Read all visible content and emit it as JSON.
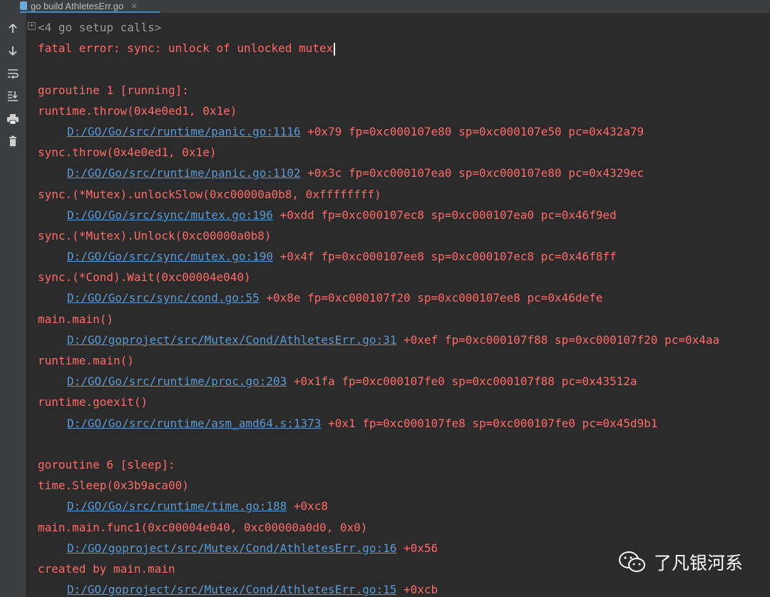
{
  "tab": {
    "title": "go build AthletesErr.go",
    "close": "×"
  },
  "toolbar": {
    "icons": [
      "up-arrow-icon",
      "down-arrow-icon",
      "soft-wrap-icon",
      "scroll-to-end-icon",
      "print-icon",
      "trash-icon"
    ]
  },
  "colors": {
    "error_text": "#ff6b68",
    "link": "#5a9bd5",
    "folded": "#9a9a9a",
    "background": "#2b2b2b"
  },
  "console": {
    "lines": [
      {
        "type": "folded",
        "text": "<4 go setup calls>"
      },
      {
        "type": "text",
        "text": "fatal error: sync: unlock of unlocked mutex"
      },
      {
        "type": "blank"
      },
      {
        "type": "text",
        "text": "goroutine 1 [running]:"
      },
      {
        "type": "text",
        "text": "runtime.throw(0x4e0ed1, 0x1e)"
      },
      {
        "type": "link",
        "link": "D:/GO/Go/src/runtime/panic.go:1116",
        "suffix": " +0x79 fp=0xc000107e80 sp=0xc000107e50 pc=0x432a79"
      },
      {
        "type": "text",
        "text": "sync.throw(0x4e0ed1, 0x1e)"
      },
      {
        "type": "link",
        "link": "D:/GO/Go/src/runtime/panic.go:1102",
        "suffix": " +0x3c fp=0xc000107ea0 sp=0xc000107e80 pc=0x4329ec"
      },
      {
        "type": "text",
        "text": "sync.(*Mutex).unlockSlow(0xc00000a0b8, 0xffffffff)"
      },
      {
        "type": "link",
        "link": "D:/GO/Go/src/sync/mutex.go:196",
        "suffix": " +0xdd fp=0xc000107ec8 sp=0xc000107ea0 pc=0x46f9ed"
      },
      {
        "type": "text",
        "text": "sync.(*Mutex).Unlock(0xc00000a0b8)"
      },
      {
        "type": "link",
        "link": "D:/GO/Go/src/sync/mutex.go:190",
        "suffix": " +0x4f fp=0xc000107ee8 sp=0xc000107ec8 pc=0x46f8ff"
      },
      {
        "type": "text",
        "text": "sync.(*Cond).Wait(0xc00004e040)"
      },
      {
        "type": "link",
        "link": "D:/GO/Go/src/sync/cond.go:55",
        "suffix": " +0x8e fp=0xc000107f20 sp=0xc000107ee8 pc=0x46defe"
      },
      {
        "type": "text",
        "text": "main.main()"
      },
      {
        "type": "link",
        "link": "D:/GO/goproject/src/Mutex/Cond/AthletesErr.go:31",
        "suffix": " +0xef fp=0xc000107f88 sp=0xc000107f20 pc=0x4aa"
      },
      {
        "type": "text",
        "text": "runtime.main()"
      },
      {
        "type": "link",
        "link": "D:/GO/Go/src/runtime/proc.go:203",
        "suffix": " +0x1fa fp=0xc000107fe0 sp=0xc000107f88 pc=0x43512a"
      },
      {
        "type": "text",
        "text": "runtime.goexit()"
      },
      {
        "type": "link",
        "link": "D:/GO/Go/src/runtime/asm_amd64.s:1373",
        "suffix": " +0x1 fp=0xc000107fe8 sp=0xc000107fe0 pc=0x45d9b1"
      },
      {
        "type": "blank"
      },
      {
        "type": "text",
        "text": "goroutine 6 [sleep]:"
      },
      {
        "type": "text",
        "text": "time.Sleep(0x3b9aca00)"
      },
      {
        "type": "link",
        "link": "D:/GO/Go/src/runtime/time.go:188",
        "suffix": " +0xc8"
      },
      {
        "type": "text",
        "text": "main.main.func1(0xc00004e040, 0xc00000a0d0, 0x0)"
      },
      {
        "type": "link",
        "link": "D:/GO/goproject/src/Mutex/Cond/AthletesErr.go:16",
        "suffix": " +0x56"
      },
      {
        "type": "text",
        "text": "created by main.main"
      },
      {
        "type": "link",
        "link": "D:/GO/goproject/src/Mutex/Cond/AthletesErr.go:15",
        "suffix": " +0xcb"
      }
    ]
  },
  "watermark": {
    "text": "了凡银河系",
    "icon": "wechat-icon"
  }
}
